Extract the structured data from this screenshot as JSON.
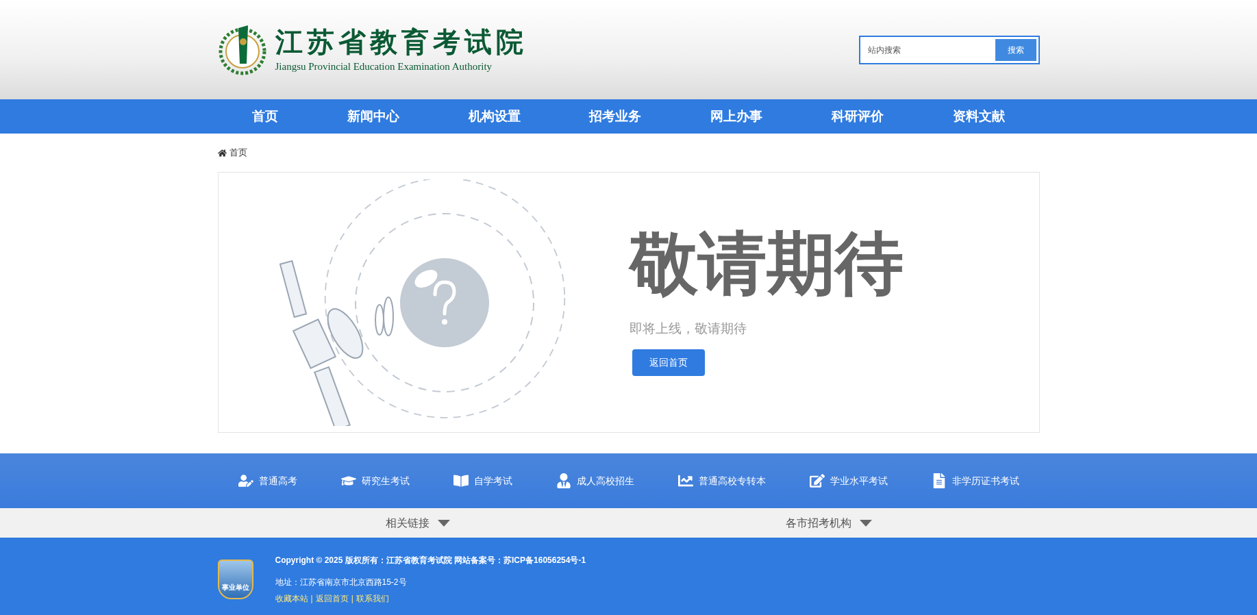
{
  "header": {
    "title": "江苏省教育考试院",
    "subtitle": "Jiangsu Provincial Education Examination Authority",
    "search": {
      "placeholder": "站内搜索",
      "button": "搜索"
    }
  },
  "nav": [
    {
      "label": "首页",
      "selected": false
    },
    {
      "label": "新闻中心",
      "selected": false
    },
    {
      "label": "机构设置",
      "selected": false
    },
    {
      "label": "招考业务",
      "selected": false
    },
    {
      "label": "网上办事",
      "selected": false
    },
    {
      "label": "科研评价",
      "selected": false
    },
    {
      "label": "资料文献",
      "selected": false
    }
  ],
  "breadcrumb": "首页",
  "notice": {
    "heading": "敬请期待",
    "message": "即将上线，敬请期待",
    "button": "返回首页"
  },
  "exams": [
    {
      "kind": "gaokao",
      "label": "普通高考"
    },
    {
      "kind": "graduate",
      "label": "研究生考试"
    },
    {
      "kind": "self",
      "label": "自学考试"
    },
    {
      "kind": "adult",
      "label": "成人高校招生"
    },
    {
      "kind": "transfer",
      "label": "普通高校专转本"
    },
    {
      "kind": "level",
      "label": "学业水平考试"
    },
    {
      "kind": "cert",
      "label": "非学历证书考试"
    }
  ],
  "dropdowns": [
    "相关链接",
    "各市招考机构"
  ],
  "footer": {
    "badge": "事业单位",
    "copyright": "Copyright © 2025 版权所有：江苏省教育考试院 网站备案号：苏ICP备16056254号-1",
    "address": "地址：江苏省南京市北京西路15-2号",
    "links": [
      "收藏本站",
      "返回首页",
      "联系我们"
    ],
    "separator": "|"
  }
}
